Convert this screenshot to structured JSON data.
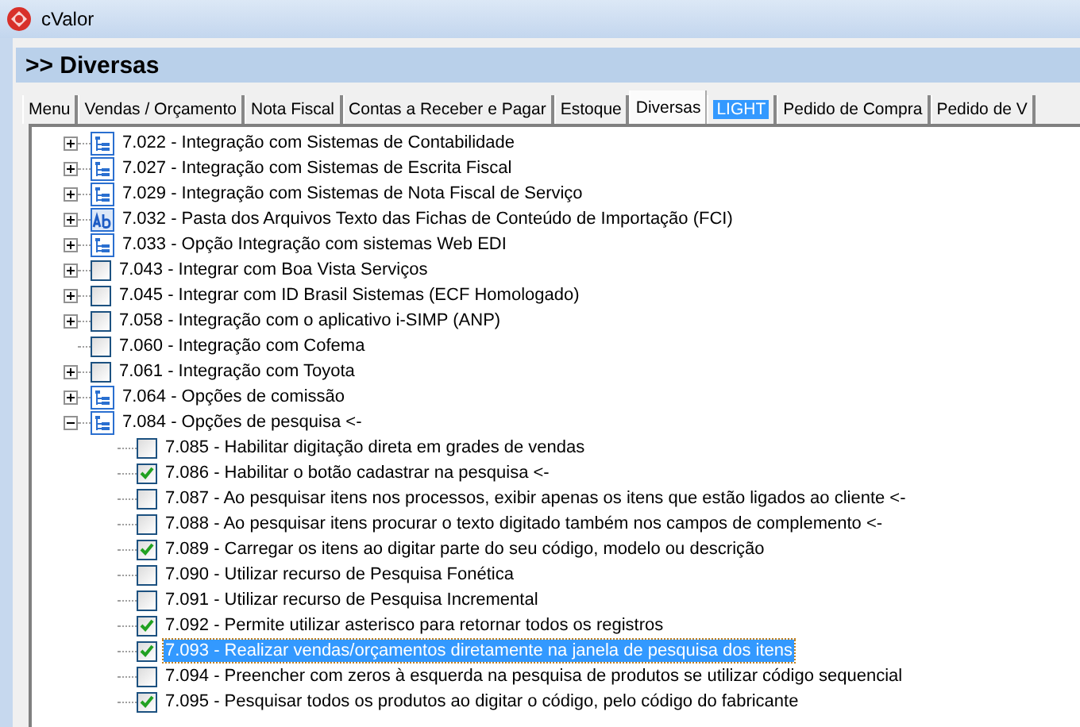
{
  "window": {
    "title": "cValor"
  },
  "header": {
    "title": ">> Diversas"
  },
  "tabs": [
    {
      "label": "Menu",
      "selected": false,
      "highlighted": false
    },
    {
      "label": "Vendas / Orçamento",
      "selected": false,
      "highlighted": false
    },
    {
      "label": "Nota Fiscal",
      "selected": false,
      "highlighted": false
    },
    {
      "label": "Contas a Receber e Pagar",
      "selected": false,
      "highlighted": false
    },
    {
      "label": "Estoque",
      "selected": false,
      "highlighted": false
    },
    {
      "label": "Diversas",
      "selected": true,
      "highlighted": false
    },
    {
      "label": "LIGHT",
      "selected": false,
      "highlighted": true
    },
    {
      "label": "Pedido de Compra",
      "selected": false,
      "highlighted": false
    },
    {
      "label": "Pedido de V",
      "selected": false,
      "highlighted": false
    }
  ],
  "tree": [
    {
      "kind": "group",
      "label": "7.022 - Integração com Sistemas de Contabilidade",
      "expandable": true,
      "expanded": false
    },
    {
      "kind": "group",
      "label": "7.027 - Integração com Sistemas de Escrita Fiscal",
      "expandable": true,
      "expanded": false
    },
    {
      "kind": "group",
      "label": "7.029 - Integração com Sistemas de Nota Fiscal de Serviço",
      "expandable": true,
      "expanded": false
    },
    {
      "kind": "text",
      "label": "7.032 - Pasta dos Arquivos Texto das Fichas de Conteúdo de Importação (FCI)",
      "expandable": true,
      "expanded": false
    },
    {
      "kind": "group",
      "label": "7.033 - Opção Integração com sistemas Web EDI",
      "expandable": true,
      "expanded": false
    },
    {
      "kind": "check",
      "label": "7.043 - Integrar com Boa Vista Serviços",
      "expandable": true,
      "expanded": false,
      "checked": false
    },
    {
      "kind": "check",
      "label": "7.045 - Integrar com ID Brasil Sistemas (ECF Homologado)",
      "expandable": true,
      "expanded": false,
      "checked": false
    },
    {
      "kind": "check",
      "label": "7.058 - Integração com o aplicativo i-SIMP (ANP)",
      "expandable": true,
      "expanded": false,
      "checked": false
    },
    {
      "kind": "check",
      "label": "7.060 - Integração com Cofema",
      "expandable": false,
      "checked": false
    },
    {
      "kind": "check",
      "label": "7.061 - Integração com Toyota",
      "expandable": true,
      "expanded": false,
      "checked": false
    },
    {
      "kind": "group",
      "label": "7.064 - Opções de comissão",
      "expandable": true,
      "expanded": false
    },
    {
      "kind": "group",
      "label": "7.084 - Opções de pesquisa <-",
      "expandable": true,
      "expanded": true,
      "children": [
        {
          "label": "7.085 - Habilitar digitação direta em grades de vendas",
          "checked": false,
          "selected": false
        },
        {
          "label": "7.086 - Habilitar o botão cadastrar na pesquisa <-",
          "checked": true,
          "selected": false
        },
        {
          "label": "7.087 - Ao pesquisar itens nos processos, exibir apenas os itens que estão ligados ao cliente <-",
          "checked": false,
          "selected": false
        },
        {
          "label": "7.088 - Ao pesquisar itens procurar o texto digitado também nos campos de complemento <-",
          "checked": false,
          "selected": false
        },
        {
          "label": "7.089 - Carregar os itens ao digitar parte do seu código, modelo ou descrição",
          "checked": true,
          "selected": false
        },
        {
          "label": "7.090 - Utilizar recurso de Pesquisa Fonética",
          "checked": false,
          "selected": false
        },
        {
          "label": "7.091 - Utilizar recurso de Pesquisa Incremental",
          "checked": false,
          "selected": false
        },
        {
          "label": "7.092 - Permite utilizar asterisco para retornar todos os registros",
          "checked": true,
          "selected": false
        },
        {
          "label": "7.093 - Realizar vendas/orçamentos diretamente na janela de pesquisa dos itens",
          "checked": true,
          "selected": true
        },
        {
          "label": "7.094 - Preencher com zeros à esquerda na pesquisa de produtos se utilizar código sequencial",
          "checked": false,
          "selected": false
        },
        {
          "label": "7.095 - Pesquisar todos os produtos ao digitar o código, pelo código do fabricante",
          "checked": true,
          "selected": false
        }
      ]
    }
  ]
}
